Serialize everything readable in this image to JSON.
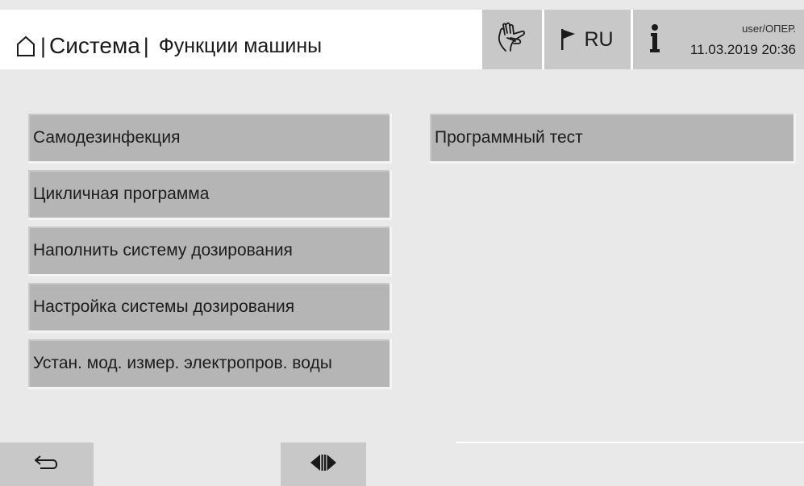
{
  "header": {
    "breadcrumb_system": "Система",
    "breadcrumb_separator": "|",
    "breadcrumb_function": "Функции машины",
    "language_code": "RU",
    "user_role": "user/ОПЕР.",
    "datetime": "11.03.2019 20:36",
    "icons": {
      "home": "home-icon",
      "hand": "hand-touch-icon",
      "flag": "flag-icon",
      "info": "info-icon"
    }
  },
  "menu_left": [
    {
      "label": "Самодезинфекция"
    },
    {
      "label": "Цикличная программа"
    },
    {
      "label": "Наполнить систему дозирования"
    },
    {
      "label": "Настройка системы дозирования"
    },
    {
      "label": "Устан. мод. измер. электропров. воды"
    }
  ],
  "menu_right": [
    {
      "label": "Программный тест"
    }
  ],
  "footer": {
    "icons": {
      "back": "back-arrow-icon",
      "split": "split-view-icon"
    }
  },
  "colors": {
    "background": "#e9e9e9",
    "button": "#b5b5b5",
    "header_button": "#c8c8c8"
  }
}
